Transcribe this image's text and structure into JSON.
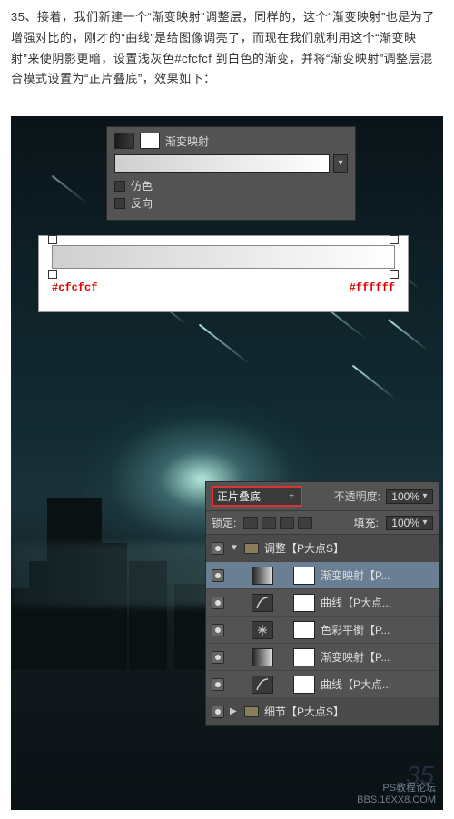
{
  "intro": "35、接着，我们新建一个“渐变映射”调整层，同样的，这个“渐变映射”也是为了增强对比的，刚才的“曲线”是给图像调亮了，而现在我们就利用这个“渐变映射”来使阴影更暗，设置浅灰色#cfcfcf 到白色的渐变，并将“渐变映射”调整层混合模式设置为“正片叠底”，效果如下：",
  "gm_panel": {
    "title": "渐变映射",
    "chk_dither": "仿色",
    "chk_reverse": "反向"
  },
  "grad_editor": {
    "left_hex": "#cfcfcf",
    "right_hex": "#ffffff"
  },
  "layers_panel": {
    "blend_mode": "正片叠底",
    "opacity_label": "不透明度:",
    "opacity_value": "100%",
    "lock_label": "锁定:",
    "fill_label": "填充:",
    "fill_value": "100%",
    "group_adjust": "调整【P大点S】",
    "layer_gradmap": "渐变映射【P...",
    "layer_curve1": "曲线【P大点...",
    "layer_colorbal": "色彩平衡【P...",
    "layer_gradmap2": "渐变映射【P...",
    "layer_curve2": "曲线【P大点...",
    "group_detail": "细节【P大点S】"
  },
  "step_number": "35",
  "watermark_line1": "PS教程论坛",
  "watermark_line2": "BBS.16XX8.COM"
}
